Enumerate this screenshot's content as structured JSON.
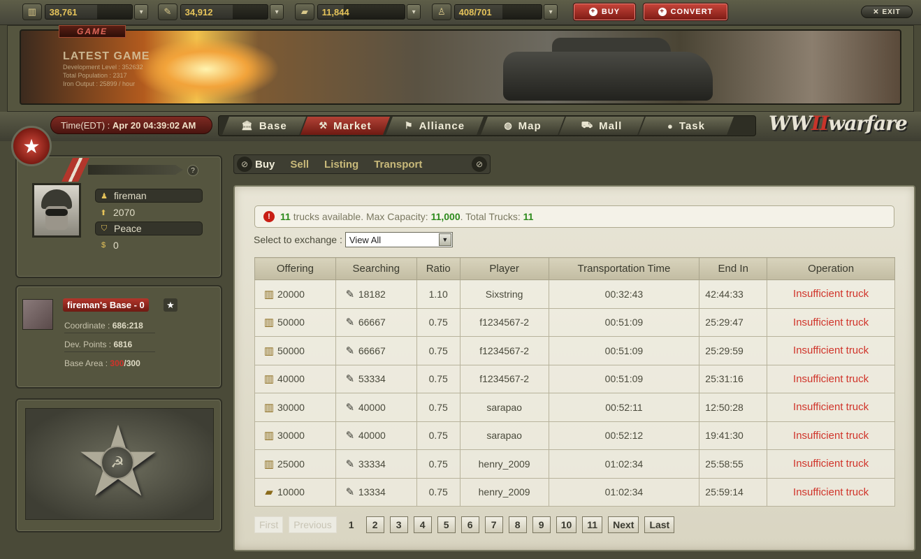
{
  "resources": [
    {
      "icon": "gold-icon",
      "value": "38,761",
      "fill": 0.6
    },
    {
      "icon": "oil-icon",
      "value": "34,912",
      "fill": 0.6
    },
    {
      "icon": "steel-icon",
      "value": "11,844",
      "fill": 0.3
    },
    {
      "icon": "population-icon",
      "value": "408/701",
      "fill": 0.55
    }
  ],
  "top_buttons": {
    "buy": "BUY",
    "convert": "CONVERT",
    "exit": "EXIT"
  },
  "banner": {
    "tag": "GAME",
    "title": "LATEST GAME",
    "lines": [
      "Development Level : 352632",
      "Total Population : 2317",
      "Iron Output : 25899 / hour"
    ]
  },
  "time": {
    "label": "Time(EDT) :",
    "value": "Apr 20 04:39:02 AM"
  },
  "nav": [
    {
      "label": "Base",
      "icon": "bank-icon",
      "active": false
    },
    {
      "label": "Market",
      "icon": "hammer-icon",
      "active": true
    },
    {
      "label": "Alliance",
      "icon": "flag-icon",
      "active": false
    },
    {
      "label": "Map",
      "icon": "globe-icon",
      "active": false
    },
    {
      "label": "Mall",
      "icon": "cart-icon",
      "active": false
    },
    {
      "label": "Task",
      "icon": "lightbulb-icon",
      "active": false
    }
  ],
  "logo": {
    "part1": "WW",
    "part2": "II",
    "part3": "warfare"
  },
  "profile": {
    "name": "fireman",
    "rank": "2070",
    "status": "Peace",
    "money": "0"
  },
  "base": {
    "name": "fireman's Base - 0",
    "coordinate_label": "Coordinate :",
    "coordinate": "686:218",
    "dev_label": "Dev. Points :",
    "dev": "6816",
    "area_label": "Base Area :",
    "area_used": "300",
    "area_total": "/300"
  },
  "subtabs": [
    "Buy",
    "Sell",
    "Listing",
    "Transport"
  ],
  "active_subtab": "Buy",
  "alert": {
    "trucks": "11",
    "trucks_text": "trucks available. Max Capacity:",
    "capacity": "11,000",
    "total_text": ". Total Trucks:",
    "total": "11"
  },
  "exchange": {
    "label": "Select to exchange :",
    "selected": "View All"
  },
  "table": {
    "headers": [
      "Offering",
      "Searching",
      "Ratio",
      "Player",
      "Transportation Time",
      "End In",
      "Operation"
    ],
    "rows": [
      {
        "offer_icon": "gold-icon",
        "offering": "20000",
        "searching": "18182",
        "ratio": "1.10",
        "player": "Sixstring",
        "time": "00:32:43",
        "end": "42:44:33",
        "op": "Insufficient truck"
      },
      {
        "offer_icon": "gold-icon",
        "offering": "50000",
        "searching": "66667",
        "ratio": "0.75",
        "player": "f1234567-2",
        "time": "00:51:09",
        "end": "25:29:47",
        "op": "Insufficient truck"
      },
      {
        "offer_icon": "gold-icon",
        "offering": "50000",
        "searching": "66667",
        "ratio": "0.75",
        "player": "f1234567-2",
        "time": "00:51:09",
        "end": "25:29:59",
        "op": "Insufficient truck"
      },
      {
        "offer_icon": "gold-icon",
        "offering": "40000",
        "searching": "53334",
        "ratio": "0.75",
        "player": "f1234567-2",
        "time": "00:51:09",
        "end": "25:31:16",
        "op": "Insufficient truck"
      },
      {
        "offer_icon": "gold-icon",
        "offering": "30000",
        "searching": "40000",
        "ratio": "0.75",
        "player": "sarapao",
        "time": "00:52:11",
        "end": "12:50:28",
        "op": "Insufficient truck"
      },
      {
        "offer_icon": "gold-icon",
        "offering": "30000",
        "searching": "40000",
        "ratio": "0.75",
        "player": "sarapao",
        "time": "00:52:12",
        "end": "19:41:30",
        "op": "Insufficient truck"
      },
      {
        "offer_icon": "gold-icon",
        "offering": "25000",
        "searching": "33334",
        "ratio": "0.75",
        "player": "henry_2009",
        "time": "01:02:34",
        "end": "25:58:55",
        "op": "Insufficient truck"
      },
      {
        "offer_icon": "steel-icon",
        "offering": "10000",
        "searching": "13334",
        "ratio": "0.75",
        "player": "henry_2009",
        "time": "01:02:34",
        "end": "25:59:14",
        "op": "Insufficient truck"
      }
    ]
  },
  "pager": {
    "first": "First",
    "previous": "Previous",
    "current": "1",
    "pages": [
      "2",
      "3",
      "4",
      "5",
      "6",
      "7",
      "8",
      "9",
      "10",
      "11"
    ],
    "next": "Next",
    "last": "Last"
  }
}
